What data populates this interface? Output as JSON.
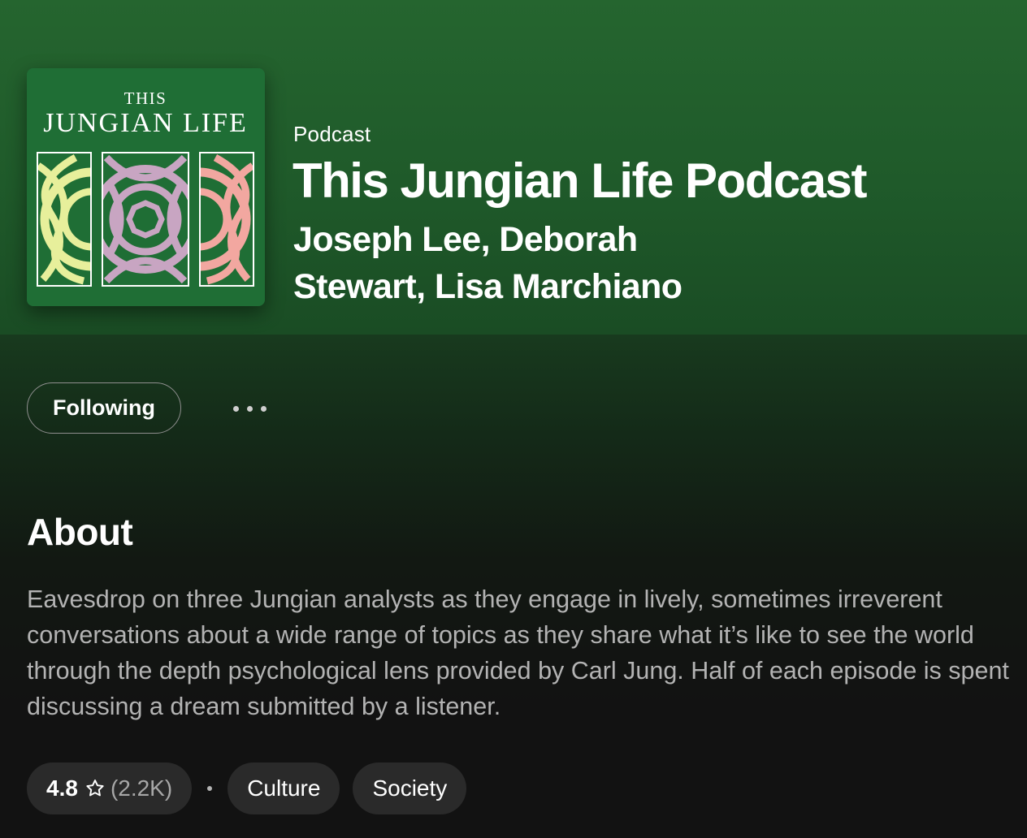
{
  "podcast": {
    "type_label": "Podcast",
    "title": "This Jungian Life Podcast",
    "authors": "Joseph Lee, Deborah Stewart, Lisa Marchiano",
    "cover": {
      "line1": "THIS",
      "line2": "JUNGIAN LIFE",
      "colors": {
        "background": "#1f6e35",
        "left_panel": "#e7ef9b",
        "center_panel": "#c8a5c2",
        "right_panel": "#f2a7a0"
      }
    }
  },
  "actions": {
    "follow_label": "Following",
    "more_icon": "more-horizontal-icon"
  },
  "about": {
    "heading": "About",
    "description": "Eavesdrop on three Jungian analysts as they engage in lively, sometimes irreverent conversations about a wide range of topics as they share what it’s like to see the world through the depth psychological lens provided by Carl Jung. Half of each episode is spent discussing a dream submitted by a listener."
  },
  "rating": {
    "value": "4.8",
    "count": "(2.2K)",
    "icon": "star-outline-icon"
  },
  "categories": [
    "Culture",
    "Society"
  ],
  "theme": {
    "hero_green": "#25652f",
    "page_background": "#121212",
    "chip_background": "#2a2a2a",
    "muted_text": "#b3b3b3"
  }
}
